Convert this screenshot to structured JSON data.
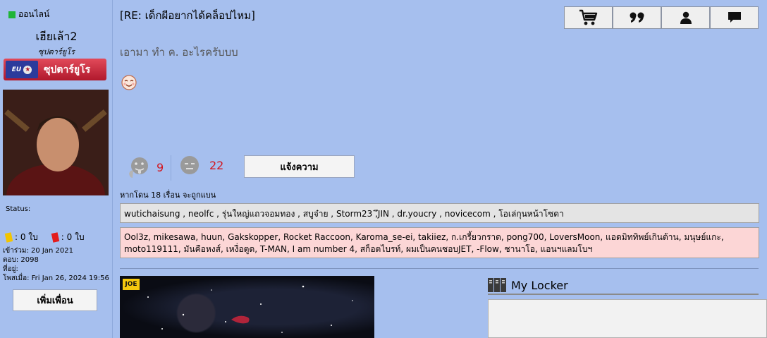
{
  "sidebar": {
    "online_label": "ออนไลน์",
    "username": "เฮียเล้า2",
    "user_title": "ซุปตาร์ยูโร",
    "rank_badge": {
      "logo_text": "EU",
      "label": "ซุปตาร์ยูโร"
    },
    "status_label": "Status:",
    "yellow_cards": ": 0 ใบ",
    "red_cards": ": 0 ใบ",
    "joined": "เข้าร่วม: 20 Jan 2021",
    "replies": "ตอบ: 2098",
    "location": "ที่อยู่:",
    "posted": "โพสเมื่อ: Fri Jan 26, 2024 19:56",
    "add_friend_label": "เพิ่มเพื่อน"
  },
  "post": {
    "title": "[RE: เด็กผีอยากได้คล็อปไหม]",
    "body": "เอามา ทำ ค. อะไรครับบบ",
    "like_count": "9",
    "dislike_count": "22",
    "report_label": "แจ้งความ",
    "ban_note": "หากโดน 18 เรื่อน จะถูกแบน",
    "likers": "wutichaisung , neolfc , รุ่นใหญ่แถวจอมทอง , สบูจ๋าย , Storm23 ,ึJIN , dr.youcry , novicecom , โอเล่กุนหน้าโซดา",
    "dislikers": "Ool3z, mikesawa, huun, Gakskopper, Rocket Raccoon, Karoma_se-ei, takiiez, ก.เกรี้ยวกราด, pong700, LoversMoon, แอดมิททิพย์เกินต้าน, มนุษย์แกะ, moto119111, มันคือหงส์, เหงื่อตูด, T-MAN, I am number 4, สก็อตไบรท์, ผมเป็นคนชอบJET, -Flow, ชานาโอ, แอนฯแลมโบฯ"
  },
  "signature": {
    "badge_text": "JOE"
  },
  "locker": {
    "title": "My Locker"
  },
  "toolbar": {
    "icons": [
      "cart-icon",
      "quote-icon",
      "profile-icon",
      "message-icon"
    ]
  },
  "colors": {
    "background": "#a6bfee",
    "online": "#1fb536",
    "count": "#d3161f",
    "rank_badge": "#c42033"
  }
}
